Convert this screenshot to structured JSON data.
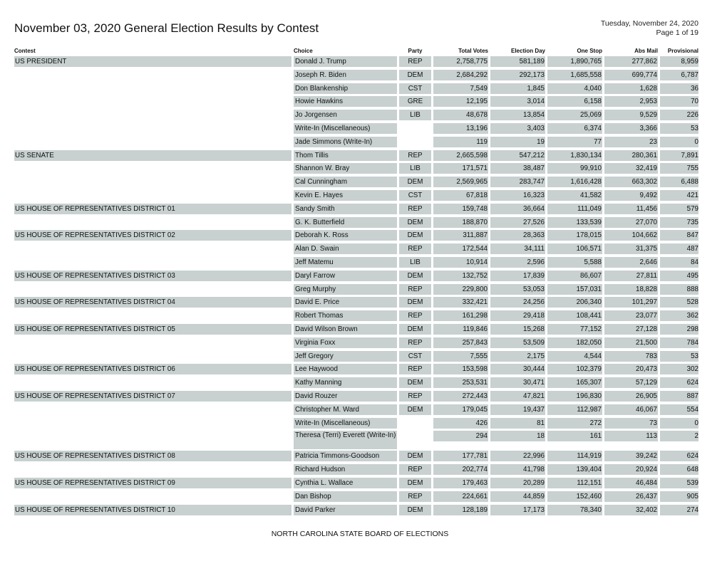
{
  "header": {
    "title": "November 03, 2020 General Election Results by Contest",
    "date": "Tuesday, November 24, 2020",
    "page": "Page 1 of 19"
  },
  "columns": {
    "contest": "Contest",
    "choice": "Choice",
    "party": "Party",
    "total": "Total Votes",
    "election_day": "Election Day",
    "one_stop": "One Stop",
    "abs_mail": "Abs Mail",
    "provisional": "Provisional"
  },
  "rows": [
    {
      "contest": "US PRESIDENT",
      "choice": "Donald J. Trump",
      "party": "REP",
      "total": "2,758,775",
      "election_day": "581,189",
      "one_stop": "1,890,765",
      "abs_mail": "277,862",
      "provisional": "8,959"
    },
    {
      "contest": "",
      "choice": "Joseph R. Biden",
      "party": "DEM",
      "total": "2,684,292",
      "election_day": "292,173",
      "one_stop": "1,685,558",
      "abs_mail": "699,774",
      "provisional": "6,787"
    },
    {
      "contest": "",
      "choice": "Don Blankenship",
      "party": "CST",
      "total": "7,549",
      "election_day": "1,845",
      "one_stop": "4,040",
      "abs_mail": "1,628",
      "provisional": "36"
    },
    {
      "contest": "",
      "choice": "Howie Hawkins",
      "party": "GRE",
      "total": "12,195",
      "election_day": "3,014",
      "one_stop": "6,158",
      "abs_mail": "2,953",
      "provisional": "70"
    },
    {
      "contest": "",
      "choice": "Jo Jorgensen",
      "party": "LIB",
      "total": "48,678",
      "election_day": "13,854",
      "one_stop": "25,069",
      "abs_mail": "9,529",
      "provisional": "226"
    },
    {
      "contest": "",
      "choice": "Write-In (Miscellaneous)",
      "party": "",
      "total": "13,196",
      "election_day": "3,403",
      "one_stop": "6,374",
      "abs_mail": "3,366",
      "provisional": "53"
    },
    {
      "contest": "",
      "choice": "Jade Simmons (Write-In)",
      "party": "",
      "total": "119",
      "election_day": "19",
      "one_stop": "77",
      "abs_mail": "23",
      "provisional": "0"
    },
    {
      "contest": "US SENATE",
      "choice": "Thom Tillis",
      "party": "REP",
      "total": "2,665,598",
      "election_day": "547,212",
      "one_stop": "1,830,134",
      "abs_mail": "280,361",
      "provisional": "7,891"
    },
    {
      "contest": "",
      "choice": "Shannon W. Bray",
      "party": "LIB",
      "total": "171,571",
      "election_day": "38,487",
      "one_stop": "99,910",
      "abs_mail": "32,419",
      "provisional": "755"
    },
    {
      "contest": "",
      "choice": "Cal Cunningham",
      "party": "DEM",
      "total": "2,569,965",
      "election_day": "283,747",
      "one_stop": "1,616,428",
      "abs_mail": "663,302",
      "provisional": "6,488"
    },
    {
      "contest": "",
      "choice": "Kevin E. Hayes",
      "party": "CST",
      "total": "67,818",
      "election_day": "16,323",
      "one_stop": "41,582",
      "abs_mail": "9,492",
      "provisional": "421"
    },
    {
      "contest": "US HOUSE OF REPRESENTATIVES DISTRICT 01",
      "choice": "Sandy Smith",
      "party": "REP",
      "total": "159,748",
      "election_day": "36,664",
      "one_stop": "111,049",
      "abs_mail": "11,456",
      "provisional": "579"
    },
    {
      "contest": "",
      "choice": "G. K. Butterfield",
      "party": "DEM",
      "total": "188,870",
      "election_day": "27,526",
      "one_stop": "133,539",
      "abs_mail": "27,070",
      "provisional": "735"
    },
    {
      "contest": "US HOUSE OF REPRESENTATIVES DISTRICT 02",
      "choice": "Deborah K. Ross",
      "party": "DEM",
      "total": "311,887",
      "election_day": "28,363",
      "one_stop": "178,015",
      "abs_mail": "104,662",
      "provisional": "847"
    },
    {
      "contest": "",
      "choice": "Alan D. Swain",
      "party": "REP",
      "total": "172,544",
      "election_day": "34,111",
      "one_stop": "106,571",
      "abs_mail": "31,375",
      "provisional": "487"
    },
    {
      "contest": "",
      "choice": "Jeff Matemu",
      "party": "LIB",
      "total": "10,914",
      "election_day": "2,596",
      "one_stop": "5,588",
      "abs_mail": "2,646",
      "provisional": "84"
    },
    {
      "contest": "US HOUSE OF REPRESENTATIVES DISTRICT 03",
      "choice": "Daryl Farrow",
      "party": "DEM",
      "total": "132,752",
      "election_day": "17,839",
      "one_stop": "86,607",
      "abs_mail": "27,811",
      "provisional": "495"
    },
    {
      "contest": "",
      "choice": "Greg Murphy",
      "party": "REP",
      "total": "229,800",
      "election_day": "53,053",
      "one_stop": "157,031",
      "abs_mail": "18,828",
      "provisional": "888"
    },
    {
      "contest": "US HOUSE OF REPRESENTATIVES DISTRICT 04",
      "choice": "David E. Price",
      "party": "DEM",
      "total": "332,421",
      "election_day": "24,256",
      "one_stop": "206,340",
      "abs_mail": "101,297",
      "provisional": "528"
    },
    {
      "contest": "",
      "choice": "Robert Thomas",
      "party": "REP",
      "total": "161,298",
      "election_day": "29,418",
      "one_stop": "108,441",
      "abs_mail": "23,077",
      "provisional": "362"
    },
    {
      "contest": "US HOUSE OF REPRESENTATIVES DISTRICT 05",
      "choice": "David Wilson Brown",
      "party": "DEM",
      "total": "119,846",
      "election_day": "15,268",
      "one_stop": "77,152",
      "abs_mail": "27,128",
      "provisional": "298"
    },
    {
      "contest": "",
      "choice": "Virginia Foxx",
      "party": "REP",
      "total": "257,843",
      "election_day": "53,509",
      "one_stop": "182,050",
      "abs_mail": "21,500",
      "provisional": "784"
    },
    {
      "contest": "",
      "choice": "Jeff Gregory",
      "party": "CST",
      "total": "7,555",
      "election_day": "2,175",
      "one_stop": "4,544",
      "abs_mail": "783",
      "provisional": "53"
    },
    {
      "contest": "US HOUSE OF REPRESENTATIVES DISTRICT 06",
      "choice": "Lee Haywood",
      "party": "REP",
      "total": "153,598",
      "election_day": "30,444",
      "one_stop": "102,379",
      "abs_mail": "20,473",
      "provisional": "302"
    },
    {
      "contest": "",
      "choice": "Kathy Manning",
      "party": "DEM",
      "total": "253,531",
      "election_day": "30,471",
      "one_stop": "165,307",
      "abs_mail": "57,129",
      "provisional": "624"
    },
    {
      "contest": "US HOUSE OF REPRESENTATIVES DISTRICT 07",
      "choice": "David Rouzer",
      "party": "REP",
      "total": "272,443",
      "election_day": "47,821",
      "one_stop": "196,830",
      "abs_mail": "26,905",
      "provisional": "887"
    },
    {
      "contest": "",
      "choice": "Christopher M. Ward",
      "party": "DEM",
      "total": "179,045",
      "election_day": "19,437",
      "one_stop": "112,987",
      "abs_mail": "46,067",
      "provisional": "554"
    },
    {
      "contest": "",
      "choice": "Write-In (Miscellaneous)",
      "party": "",
      "total": "426",
      "election_day": "81",
      "one_stop": "272",
      "abs_mail": "73",
      "provisional": "0"
    },
    {
      "contest": "",
      "choice": "Theresa (Terri) Everett (Write-In)",
      "party": "",
      "total": "294",
      "election_day": "18",
      "one_stop": "161",
      "abs_mail": "113",
      "provisional": "2",
      "tall": true
    },
    {
      "contest": "US HOUSE OF REPRESENTATIVES DISTRICT 08",
      "choice": "Patricia Timmons-Goodson",
      "party": "DEM",
      "total": "177,781",
      "election_day": "22,996",
      "one_stop": "114,919",
      "abs_mail": "39,242",
      "provisional": "624"
    },
    {
      "contest": "",
      "choice": "Richard Hudson",
      "party": "REP",
      "total": "202,774",
      "election_day": "41,798",
      "one_stop": "139,404",
      "abs_mail": "20,924",
      "provisional": "648"
    },
    {
      "contest": "US HOUSE OF REPRESENTATIVES DISTRICT 09",
      "choice": "Cynthia L. Wallace",
      "party": "DEM",
      "total": "179,463",
      "election_day": "20,289",
      "one_stop": "112,151",
      "abs_mail": "46,484",
      "provisional": "539"
    },
    {
      "contest": "",
      "choice": "Dan Bishop",
      "party": "REP",
      "total": "224,661",
      "election_day": "44,859",
      "one_stop": "152,460",
      "abs_mail": "26,437",
      "provisional": "905"
    },
    {
      "contest": "US HOUSE OF REPRESENTATIVES DISTRICT 10",
      "choice": "David Parker",
      "party": "DEM",
      "total": "128,189",
      "election_day": "17,173",
      "one_stop": "78,340",
      "abs_mail": "32,402",
      "provisional": "274"
    }
  ],
  "footer": {
    "text": "NORTH CAROLINA STATE BOARD OF ELECTIONS"
  }
}
